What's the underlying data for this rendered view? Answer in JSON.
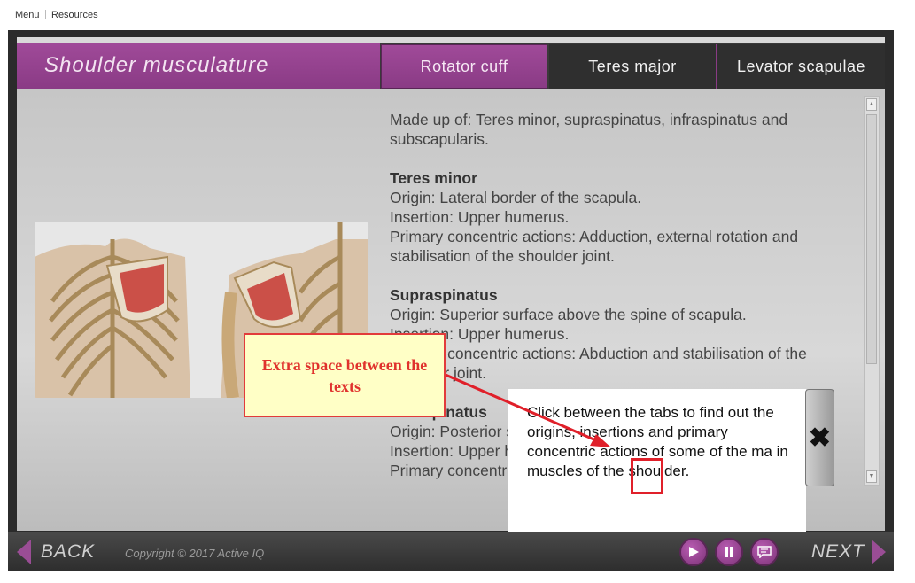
{
  "top_menu": {
    "menu": "Menu",
    "resources": "Resources"
  },
  "header": {
    "title": "Shoulder musculature",
    "tabs": [
      {
        "label": "Rotator cuff",
        "active": true
      },
      {
        "label": "Teres major",
        "active": false
      },
      {
        "label": "Levator scapulae",
        "active": false
      }
    ]
  },
  "content": {
    "intro": "Made up of: Teres minor, supraspinatus, infraspinatus and subscapularis.",
    "sections": [
      {
        "heading": "Teres minor",
        "lines": [
          "Origin: Lateral border of the scapula.",
          "Insertion: Upper humerus.",
          "Primary concentric actions: Adduction, external rotation and stabilisation of the shoulder joint."
        ]
      },
      {
        "heading": "Supraspinatus",
        "lines": [
          "Origin: Superior surface above the spine of scapula.",
          "Insertion: Upper humerus.",
          "Primary concentric actions: Abduction and stabilisation of the shoulder joint."
        ]
      },
      {
        "heading": "Infraspinatus",
        "lines": [
          "Origin: Posterior surface below the spine of scapula.",
          "Insertion: Upper humerus.",
          "Primary concentric actions: External rotation and horizontal"
        ]
      }
    ]
  },
  "popup": {
    "text": "Click between the tabs to find out the origins, insertions and primary concentric actions of some of the ma in muscles of the shoulder.",
    "close": "✖"
  },
  "annotation": {
    "text": "Extra space between the texts"
  },
  "footer": {
    "back": "BACK",
    "copyright": "Copyright © 2017 Active IQ",
    "next": "NEXT"
  },
  "colors": {
    "accent": "#8a3b85",
    "annotation": "#e0322d"
  },
  "icons": {
    "play": "play-icon",
    "pause": "pause-icon",
    "transcript": "speech-bubble-icon"
  }
}
